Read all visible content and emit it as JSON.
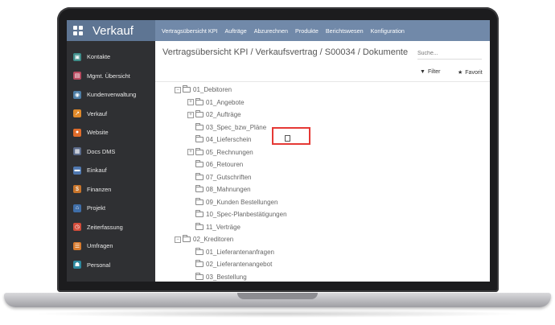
{
  "app": {
    "title": "Verkauf"
  },
  "topmenu": [
    "Vertragsübersicht KPI",
    "Aufträge",
    "Abzurechnen",
    "Produkte",
    "Berichtswesen",
    "Konfiguration"
  ],
  "sidebar": {
    "items": [
      {
        "label": "Kontakte",
        "color": "#3f8e8a"
      },
      {
        "label": "Mgmt. Übersicht",
        "color": "#b94a5f"
      },
      {
        "label": "Kundenverwaltung",
        "color": "#4e7ea6"
      },
      {
        "label": "Verkauf",
        "color": "#e08a2b"
      },
      {
        "label": "Website",
        "color": "#e06c2b"
      },
      {
        "label": "Docs DMS",
        "color": "#5b6b8a"
      },
      {
        "label": "Einkauf",
        "color": "#4f78b0"
      },
      {
        "label": "Finanzen",
        "color": "#c8742a"
      },
      {
        "label": "Projekt",
        "color": "#3f6ea8"
      },
      {
        "label": "Zeiterfassung",
        "color": "#d24c3a"
      },
      {
        "label": "Umfragen",
        "color": "#d87b2e"
      },
      {
        "label": "Personal",
        "color": "#2f8aa0"
      }
    ]
  },
  "breadcrumb": "Vertragsübersicht KPI / Verkaufsvertrag / S00034 / Dokumente",
  "search": {
    "placeholder": "Suche..."
  },
  "toolbar": {
    "filter": "Filter",
    "favorites": "Favorit"
  },
  "tree": [
    {
      "label": "01_Debitoren",
      "expander": "−"
    },
    {
      "label": "01_Angebote",
      "expander": "+"
    },
    {
      "label": "02_Aufträge",
      "expander": "+"
    },
    {
      "label": "03_Spec_bzw_Pläne",
      "expander": ""
    },
    {
      "label": "04_Lieferschein",
      "expander": ""
    },
    {
      "label": "05_Rechnungen",
      "expander": "+"
    },
    {
      "label": "06_Retouren",
      "expander": ""
    },
    {
      "label": "07_Gutschriften",
      "expander": ""
    },
    {
      "label": "08_Mahnungen",
      "expander": ""
    },
    {
      "label": "09_Kunden Bestellungen",
      "expander": ""
    },
    {
      "label": "10_Spec-Planbestätigungen",
      "expander": ""
    },
    {
      "label": "11_Verträge",
      "expander": ""
    },
    {
      "label": "02_Kreditoren",
      "expander": "−"
    },
    {
      "label": "01_Lieferantenanfragen",
      "expander": ""
    },
    {
      "label": "02_Lieferantenangebot",
      "expander": ""
    },
    {
      "label": "03_Bestellung",
      "expander": ""
    }
  ]
}
